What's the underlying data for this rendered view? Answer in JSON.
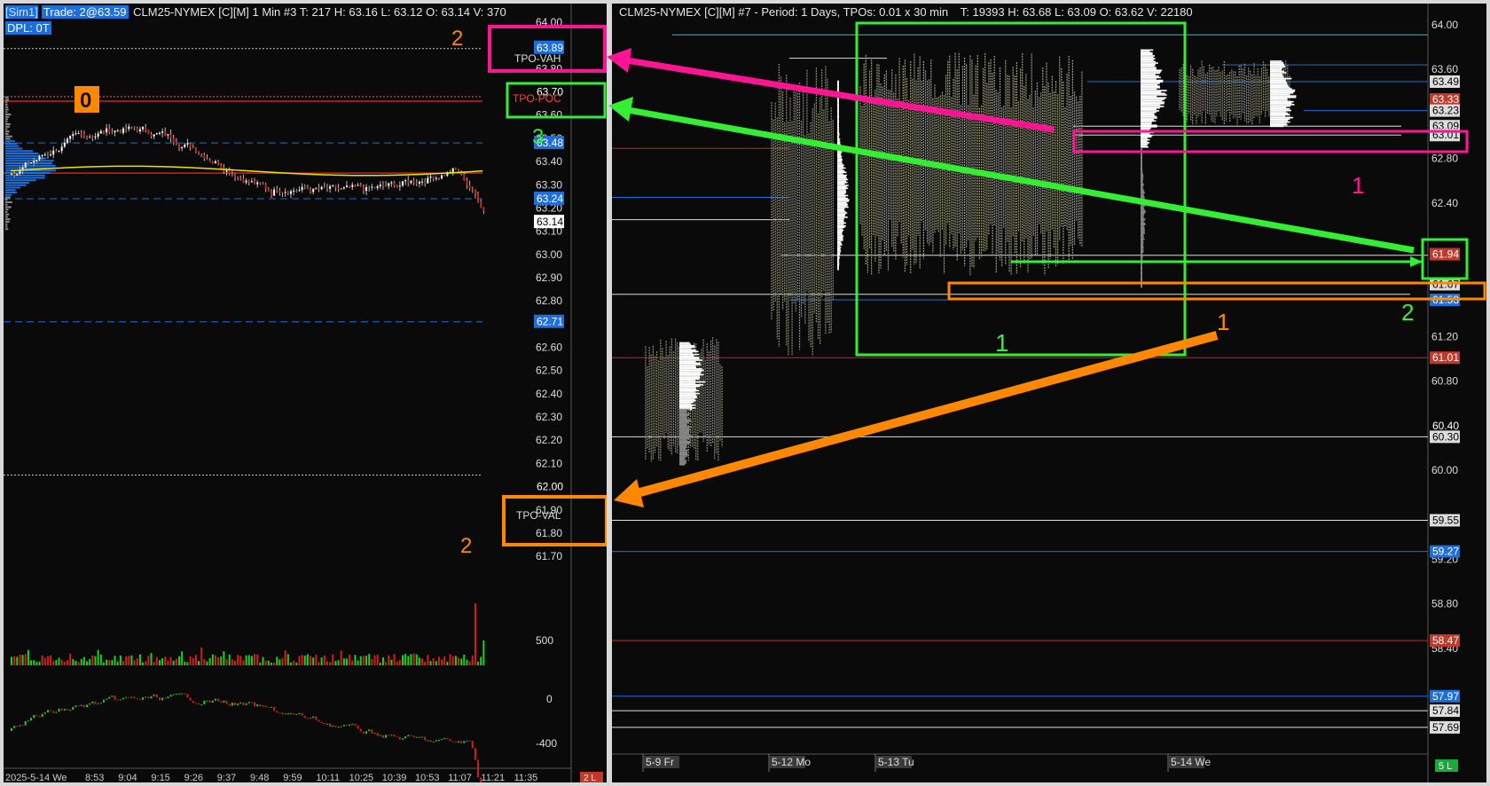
{
  "left_chart": {
    "header": {
      "account": "[Sim1]",
      "trade": "Trade: 2@63.59",
      "title": "CLM25-NYMEX [C][M]  1 Min  #3 T: 217 H: 63.16 L: 63.12 O: 63.14 V: 370",
      "dpl": "DPL: 0T"
    },
    "price_axis": [
      "64.00",
      "63.90",
      "63.80",
      "63.70",
      "63.60",
      "63.50",
      "63.40",
      "63.30",
      "63.20",
      "63.10",
      "63.00",
      "62.90",
      "62.80",
      "62.70",
      "62.60",
      "62.50",
      "62.40",
      "62.30",
      "62.20",
      "62.10",
      "62.00",
      "61.90",
      "61.80",
      "61.70"
    ],
    "price_tags": [
      {
        "value": "63.89",
        "color": "#1e6fd9"
      },
      {
        "value": "63.70",
        "color": "#0a0a0a"
      },
      {
        "value": "63.48",
        "color": "#1e6fd9"
      },
      {
        "value": "63.24",
        "color": "#1e6fd9"
      },
      {
        "value": "63.14",
        "color": "#ffffff"
      },
      {
        "value": "62.71",
        "color": "#1e6fd9"
      },
      {
        "value": "62.00",
        "color": "#0a0a0a"
      }
    ],
    "line_labels": {
      "vah": "TPO-VAH",
      "poc": "TPO-POC",
      "val": "TPO-VAL"
    },
    "volume_axis": [
      "500"
    ],
    "delta_axis": [
      "0",
      "-400"
    ],
    "time_axis": [
      "2025-5-14 We",
      "8:53",
      "9:04",
      "9:15",
      "9:26",
      "9:37",
      "9:48",
      "9:59",
      "10:11",
      "10:25",
      "10:39",
      "10:53",
      "11:07",
      "11:21",
      "11:35"
    ],
    "corner_badge": "2 L"
  },
  "right_chart": {
    "header": {
      "title": "CLM25-NYMEX [C][M] #7 - Period: 1 Days, TPOs: 0.01 x 30 min",
      "stats": "T: 19393 H: 63.68 L: 63.09 O: 63.62 V: 22180"
    },
    "price_axis": [
      "64.00",
      "63.60",
      "62.80",
      "62.40",
      "61.20",
      "60.80",
      "60.00",
      "59.20",
      "58.80",
      "58.40"
    ],
    "price_tags": [
      {
        "value": "63.49",
        "color": "#dddddd"
      },
      {
        "value": "63.33",
        "color": "#c0392b"
      },
      {
        "value": "63.23",
        "color": "#dddddd"
      },
      {
        "value": "63.09",
        "color": "#dddddd"
      },
      {
        "value": "63.01",
        "color": "#dddddd"
      },
      {
        "value": "61.94",
        "color": "#c0392b"
      },
      {
        "value": "61.67",
        "color": "#dddddd"
      },
      {
        "value": "61.53",
        "color": "#1e6fd9"
      },
      {
        "value": "61.01",
        "color": "#c0392b"
      },
      {
        "value": "60.40",
        "color": "#0a0a0a"
      },
      {
        "value": "60.30",
        "color": "#dddddd"
      },
      {
        "value": "59.55",
        "color": "#dddddd"
      },
      {
        "value": "59.27",
        "color": "#1e6fd9"
      },
      {
        "value": "58.47",
        "color": "#c0392b"
      },
      {
        "value": "57.97",
        "color": "#1e6fd9"
      },
      {
        "value": "57.84",
        "color": "#dddddd"
      },
      {
        "value": "57.69",
        "color": "#dddddd"
      }
    ],
    "date_axis": [
      "5-9 Fr",
      "5-12 Mo",
      "5-13 Tu",
      "5-14 We"
    ],
    "corner_badge": "5 L"
  },
  "annotations": {
    "left_zero": "0",
    "left_vah_num": "2",
    "left_poc_num": "3",
    "left_val_num": "2",
    "right_green_box_num": "1",
    "right_pink_num": "1",
    "right_orange_num": "1",
    "right_green_num": "2"
  },
  "colors": {
    "annotation_pink": "#ff1493",
    "annotation_green": "#33ee33",
    "annotation_orange": "#ff8800",
    "level_blue": "#1e6fd9",
    "level_red": "#d0201a",
    "vwap_yellow": "#e6e600"
  }
}
